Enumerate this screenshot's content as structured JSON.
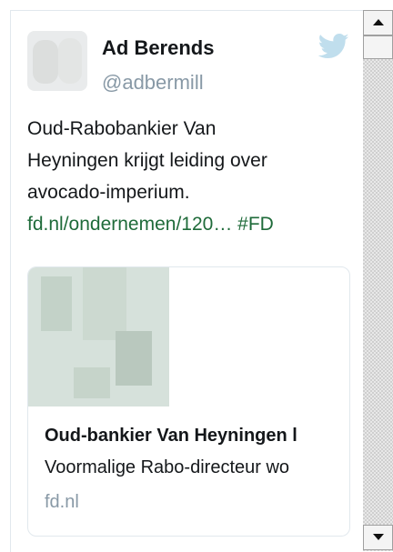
{
  "tweet": {
    "author": {
      "name": "Ad Berends",
      "handle": "@adbermill"
    },
    "text_lines": [
      "Oud-Rabobankier Van",
      "Heyningen krijgt leiding over",
      "avocado-imperium."
    ],
    "link_text": "fd.nl/ondernemen/120…",
    "hashtag": "#FD",
    "card": {
      "title": "Oud-bankier Van Heyningen l",
      "description": "Voormalige Rabo-directeur wo",
      "domain": "fd.nl"
    }
  },
  "icons": {
    "brand": "twitter-bird-icon",
    "scroll_up": "arrow-up-icon",
    "scroll_down": "arrow-down-icon"
  },
  "colors": {
    "twitter_blue": "#c0deed",
    "handle_gray": "#8899a6",
    "link_green": "#1f6b3a",
    "border": "#e1e8ed"
  }
}
